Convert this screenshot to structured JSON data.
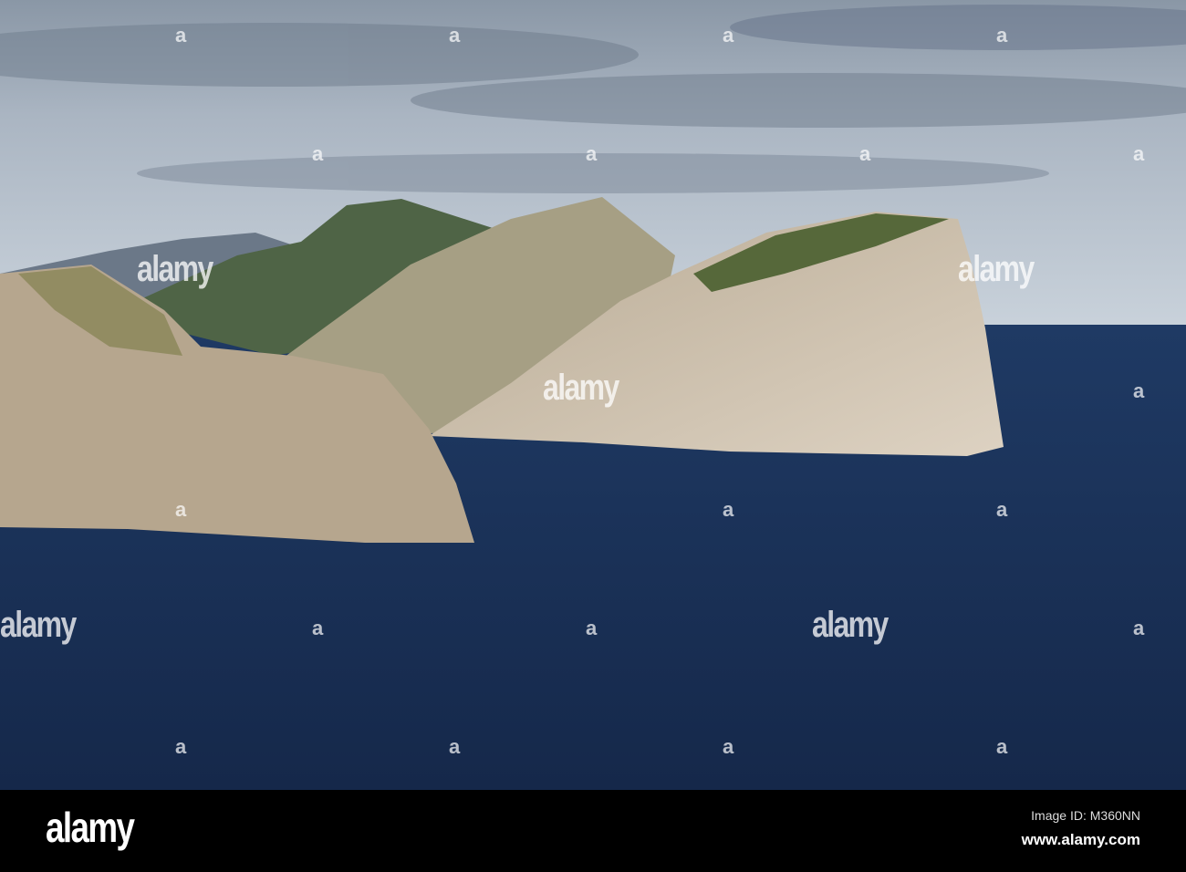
{
  "photo": {
    "subject": "Cap de Formentor coastal cliffs over deep blue sea",
    "colors": {
      "sky": "#b7c1cc",
      "cloud_dark": "#6f7c8c",
      "sea": "#1c3157",
      "cliff": "#cdbfae",
      "vegetation": "#56683a"
    }
  },
  "watermark": {
    "text": "alamy",
    "mark": "a"
  },
  "footer": {
    "logo": "alamy",
    "image_id": "Image ID: M360NN",
    "url": "www.alamy.com"
  }
}
